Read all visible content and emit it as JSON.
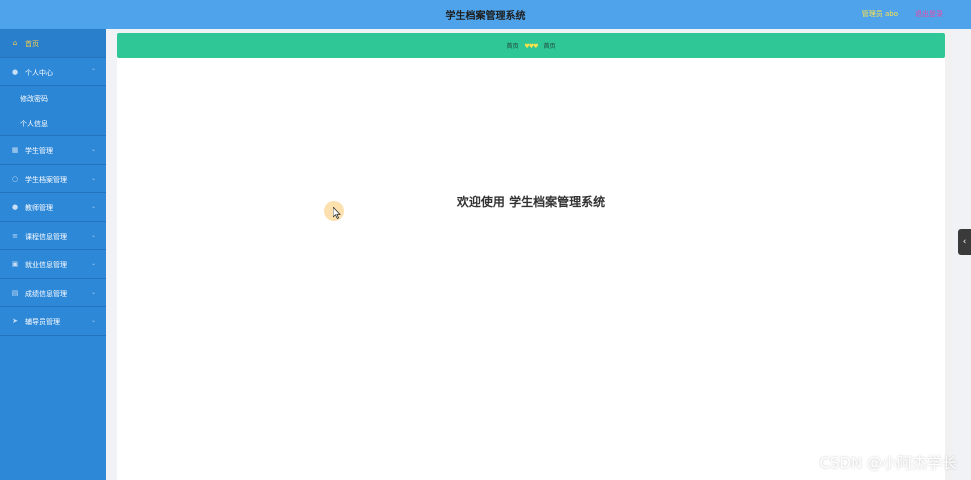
{
  "header": {
    "title": "学生档案管理系统",
    "user_label": "管理员 abo",
    "logout_label": "退出登录"
  },
  "sidebar": {
    "items": [
      {
        "label": "首页",
        "icon": "home-icon",
        "active": true
      },
      {
        "label": "个人中心",
        "icon": "user-icon",
        "children": [
          {
            "label": "修改密码"
          },
          {
            "label": "个人信息"
          }
        ]
      },
      {
        "label": "学生管理",
        "icon": "grid-icon"
      },
      {
        "label": "学生档案管理",
        "icon": "circle-icon"
      },
      {
        "label": "教师管理",
        "icon": "user-icon"
      },
      {
        "label": "课程信息管理",
        "icon": "list-icon"
      },
      {
        "label": "就业信息管理",
        "icon": "briefcase-icon"
      },
      {
        "label": "成绩信息管理",
        "icon": "chart-icon"
      },
      {
        "label": "辅导员管理",
        "icon": "send-icon"
      }
    ]
  },
  "breadcrumb": {
    "first": "首页",
    "separator": "♥♥♥",
    "second": "首页"
  },
  "main": {
    "welcome": "欢迎使用 学生档案管理系统"
  },
  "watermark": "CSDN @小阿杰学长",
  "colors": {
    "header_bg": "#4fa3ea",
    "sidebar_bg": "#2d88d8",
    "breadcrumb_bg": "#2fc795",
    "active_text": "#f7ce4a"
  }
}
